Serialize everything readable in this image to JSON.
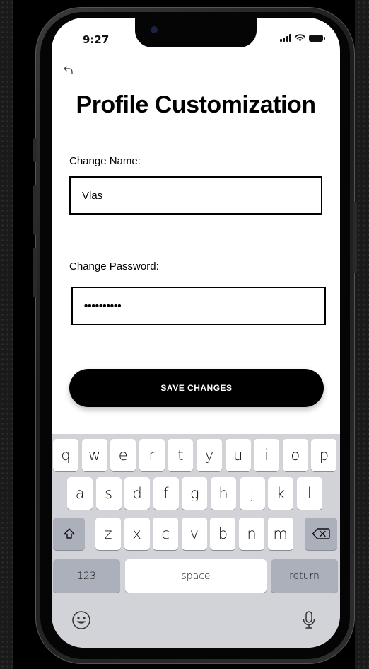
{
  "status_bar": {
    "time": "9:27"
  },
  "header": {
    "title": "Profile Customization"
  },
  "form": {
    "name_label": "Change Name:",
    "name_value": "Vlas",
    "password_label": "Change Password:",
    "password_value": "••••••••••",
    "save_label": "SAVE CHANGES"
  },
  "keyboard": {
    "row1": [
      "q",
      "w",
      "e",
      "r",
      "t",
      "y",
      "u",
      "i",
      "o",
      "p"
    ],
    "row2": [
      "a",
      "s",
      "d",
      "f",
      "g",
      "h",
      "j",
      "k",
      "l"
    ],
    "row3": [
      "z",
      "x",
      "c",
      "v",
      "b",
      "n",
      "m"
    ],
    "numbers_label": "123",
    "space_label": "space",
    "return_label": "return"
  },
  "icons": [
    "back-arrow-icon",
    "signal-icon",
    "wifi-icon",
    "battery-icon",
    "shift-icon",
    "delete-icon",
    "emoji-icon",
    "microphone-icon"
  ]
}
